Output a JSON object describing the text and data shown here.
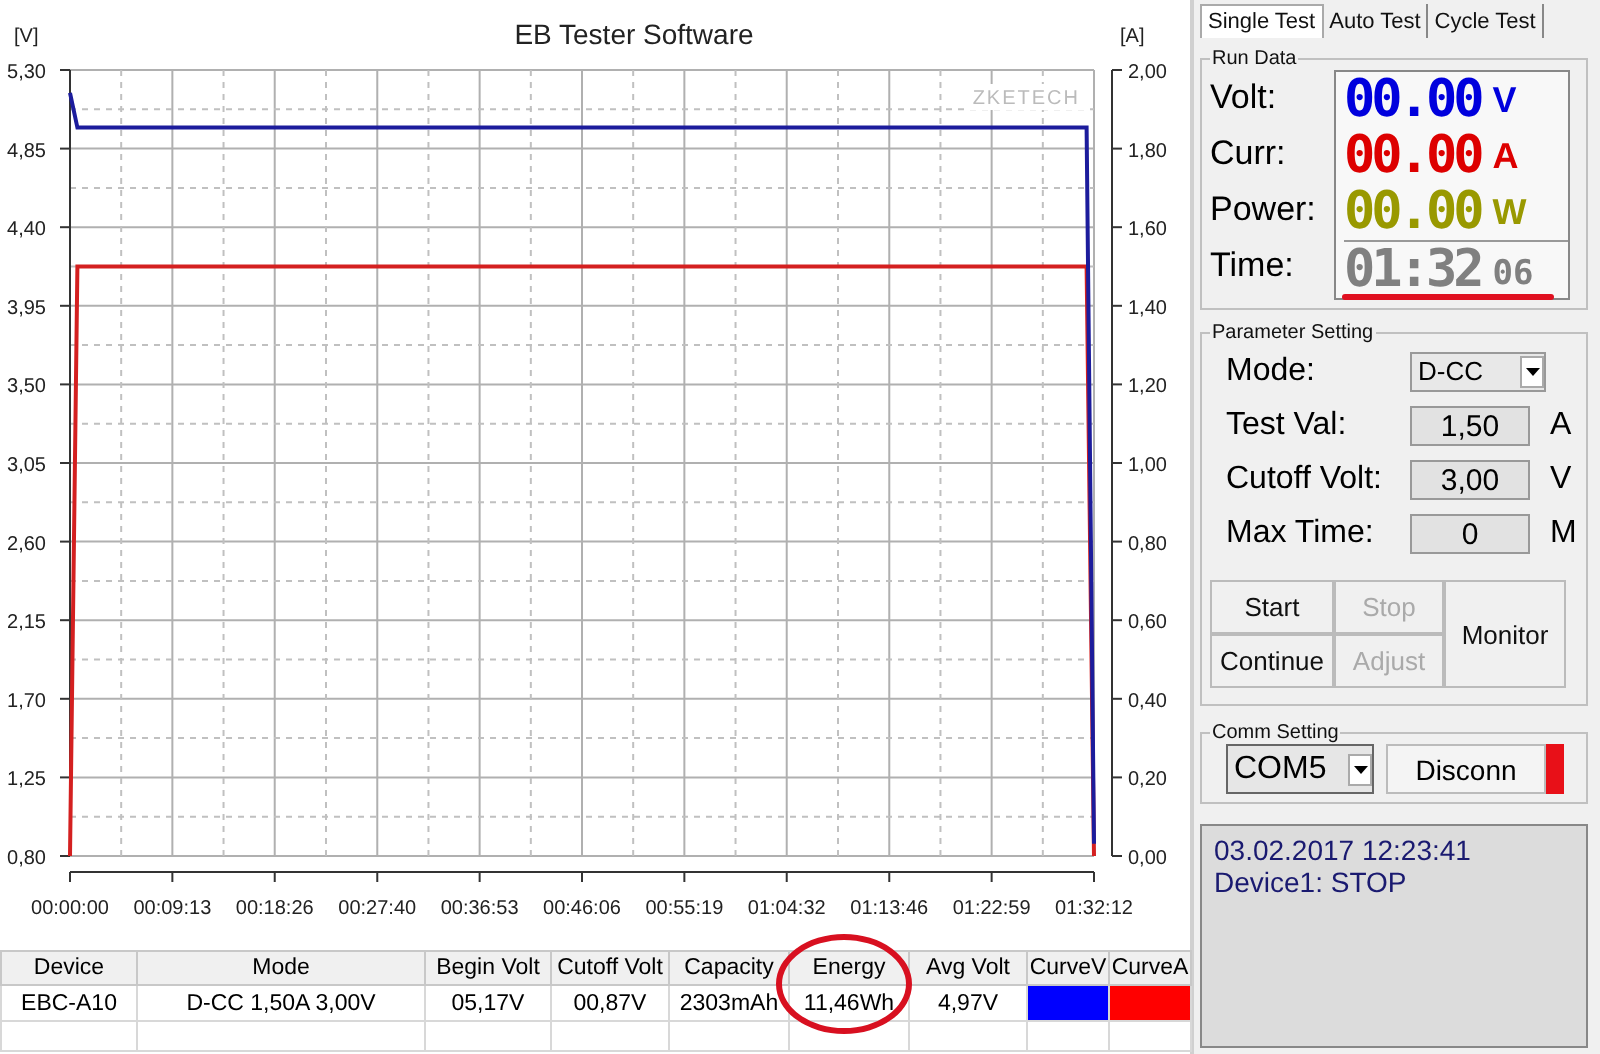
{
  "chart": {
    "title": "EB Tester Software",
    "watermark": "ZKETECH",
    "chart_data": {
      "type": "line",
      "grid": true,
      "ylabel": "[V]",
      "y2label": "[A]",
      "x": [
        0,
        40,
        5492,
        5532
      ],
      "series": [
        {
          "name": "CurveV",
          "color": "#1c1c9c",
          "axis": "y",
          "values": [
            5.17,
            4.97,
            4.97,
            0.87
          ]
        },
        {
          "name": "CurveA",
          "color": "#d42020",
          "axis": "y2",
          "values": [
            0,
            1.5,
            1.5,
            0
          ]
        }
      ],
      "xlim": [
        0,
        5532
      ],
      "ylim": [
        0.8,
        5.3
      ],
      "y2lim": [
        0,
        2
      ],
      "xticks": [
        {
          "value": 0,
          "label": "00:00:00"
        },
        {
          "value": 553,
          "label": "00:09:13"
        },
        {
          "value": 1106,
          "label": "00:18:26"
        },
        {
          "value": 1660,
          "label": "00:27:40"
        },
        {
          "value": 2213,
          "label": "00:36:53"
        },
        {
          "value": 2766,
          "label": "00:46:06"
        },
        {
          "value": 3319,
          "label": "00:55:19"
        },
        {
          "value": 3872,
          "label": "01:04:32"
        },
        {
          "value": 4426,
          "label": "01:13:46"
        },
        {
          "value": 4979,
          "label": "01:22:59"
        },
        {
          "value": 5532,
          "label": "01:32:12"
        }
      ],
      "yticks": [
        {
          "value": 5.3,
          "label": "5,30"
        },
        {
          "value": 4.85,
          "label": "4,85"
        },
        {
          "value": 4.4,
          "label": "4,40"
        },
        {
          "value": 3.95,
          "label": "3,95"
        },
        {
          "value": 3.5,
          "label": "3,50"
        },
        {
          "value": 3.05,
          "label": "3,05"
        },
        {
          "value": 2.6,
          "label": "2,60"
        },
        {
          "value": 2.15,
          "label": "2,15"
        },
        {
          "value": 1.7,
          "label": "1,70"
        },
        {
          "value": 1.25,
          "label": "1,25"
        },
        {
          "value": 0.8,
          "label": "0,80"
        }
      ],
      "y2ticks": [
        {
          "value": 2,
          "label": "2,00"
        },
        {
          "value": 1.8,
          "label": "1,80"
        },
        {
          "value": 1.6,
          "label": "1,60"
        },
        {
          "value": 1.4,
          "label": "1,40"
        },
        {
          "value": 1.2,
          "label": "1,20"
        },
        {
          "value": 1,
          "label": "1,00"
        },
        {
          "value": 0.8,
          "label": "0,80"
        },
        {
          "value": 0.6,
          "label": "0,60"
        },
        {
          "value": 0.4,
          "label": "0,40"
        },
        {
          "value": 0.2,
          "label": "0,20"
        },
        {
          "value": 0,
          "label": "0,00"
        }
      ]
    }
  },
  "table": {
    "columns": [
      "Device",
      "Mode",
      "Begin Volt",
      "Cutoff Volt",
      "Capacity",
      "Energy",
      "Avg Volt"
    ],
    "rows": [
      {
        "cells": [
          {
            "kind": "text",
            "text": "EBC-A10"
          },
          {
            "kind": "text",
            "text": "D-CC  1,50A  3,00V"
          },
          {
            "kind": "text",
            "text": "05,17V"
          },
          {
            "kind": "text",
            "text": "00,87V"
          },
          {
            "kind": "text",
            "text": "2303mAh"
          },
          {
            "kind": "text",
            "text": "11,46Wh"
          },
          {
            "kind": "text",
            "text": "4,97V"
          },
          {
            "kind": "swatch",
            "color": "#0000ff"
          },
          {
            "kind": "swatch",
            "color": "#ff0000"
          }
        ]
      }
    ]
  },
  "tabs": [
    {
      "label": "Single Test",
      "selected": true
    },
    {
      "label": "Auto Test",
      "selected": false
    },
    {
      "label": "Cycle Test",
      "selected": false
    }
  ],
  "run_data": {
    "title": "Run Data",
    "readings": [
      {
        "label": "Volt:",
        "value": "00.00",
        "unit": "V",
        "color": "#0000dd"
      },
      {
        "label": "Curr:",
        "value": "00.00",
        "unit": "A",
        "color": "#dd0000"
      },
      {
        "label": "Power:",
        "value": "00.00",
        "unit": "W",
        "color": "#999900"
      }
    ],
    "time": {
      "label": "Time:",
      "main": "01:32",
      "seconds": "06"
    }
  },
  "parameters": {
    "title": "Parameter Setting",
    "fields": [
      {
        "label": "Mode:",
        "kind": "select",
        "value": "D-CC"
      },
      {
        "label": "Test Val:",
        "kind": "input",
        "value": "1,50",
        "unit": "A"
      },
      {
        "label": "Cutoff Volt:",
        "kind": "input",
        "value": "3,00",
        "unit": "V"
      },
      {
        "label": "Max Time:",
        "kind": "input",
        "value": "0",
        "unit": "M"
      }
    ],
    "buttons": [
      {
        "label": "Start",
        "disabled": false,
        "kind": "normal"
      },
      {
        "label": "Stop",
        "disabled": true,
        "kind": "normal"
      },
      {
        "label": "Monitor",
        "disabled": false,
        "kind": "tall"
      },
      {
        "label": "Continue",
        "disabled": false,
        "kind": "normal"
      },
      {
        "label": "Adjust",
        "disabled": true,
        "kind": "normal"
      }
    ]
  },
  "comm": {
    "title": "Comm Setting",
    "port": "COM5",
    "button": "Disconn",
    "connected": true
  },
  "status": {
    "lines": [
      "03.02.2017 12:23:41",
      "Device1: STOP"
    ]
  }
}
